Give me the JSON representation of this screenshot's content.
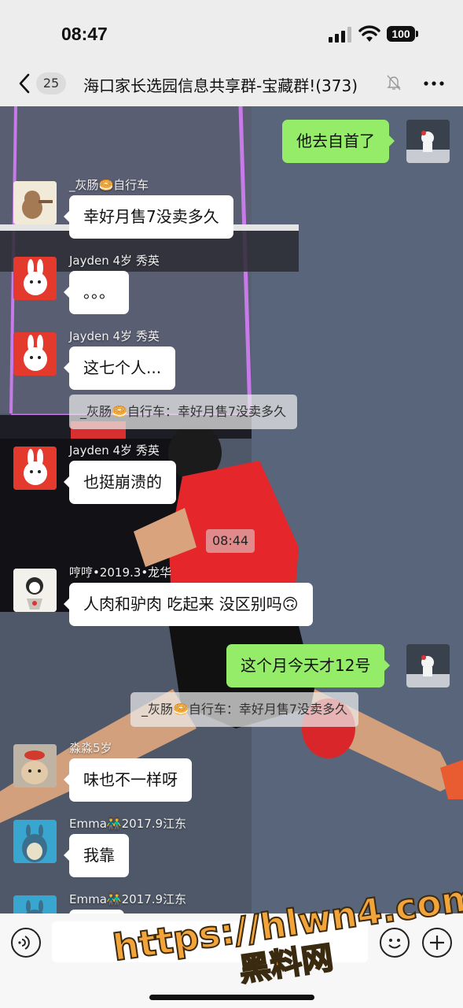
{
  "status": {
    "time": "08:47",
    "battery": "100"
  },
  "nav": {
    "unread": "25",
    "title": "海口家长选园信息共享群-宝藏群!(373)"
  },
  "messages": [
    {
      "side": "out",
      "text": "他去自首了"
    },
    {
      "side": "in",
      "sender": "_灰肠🥯自行车",
      "text": "幸好月售7没卖多久"
    },
    {
      "side": "in",
      "sender": "Jayden 4岁 秀英",
      "text": "。。。"
    },
    {
      "side": "in",
      "sender": "Jayden 4岁 秀英",
      "text": "这七个人..."
    },
    {
      "quote": "_灰肠🥯自行车：幸好月售7没卖多久"
    },
    {
      "side": "in",
      "sender": "Jayden 4岁 秀英",
      "text": "也挺崩溃的"
    },
    {
      "time": "08:44"
    },
    {
      "side": "in",
      "sender": "哼哼•2019.3•龙华",
      "text": "人肉和驴肉 吃起来 没区别吗🙃"
    },
    {
      "side": "out",
      "text": "这个月今天才12号"
    },
    {
      "quote": "_灰肠🥯自行车：幸好月售7没卖多久"
    },
    {
      "side": "in",
      "sender": "淼淼5岁",
      "text": "味也不一样呀"
    },
    {
      "side": "in",
      "sender": "Emma👬2017.9江东",
      "text": "我靠"
    },
    {
      "side": "in",
      "sender": "Emma👬2017.9江东",
      "text": ""
    }
  ],
  "watermark": {
    "url": "https://hlwn4.com",
    "name": "黑料网"
  },
  "colors": {
    "bubble_out": "#95ec69",
    "bubble_in": "#ffffff",
    "watermark": "#f2a43a"
  },
  "icons": [
    "chevron-left-icon",
    "mute-bell-icon",
    "more-dots-icon",
    "voice-icon",
    "emoji-icon",
    "plus-icon"
  ]
}
